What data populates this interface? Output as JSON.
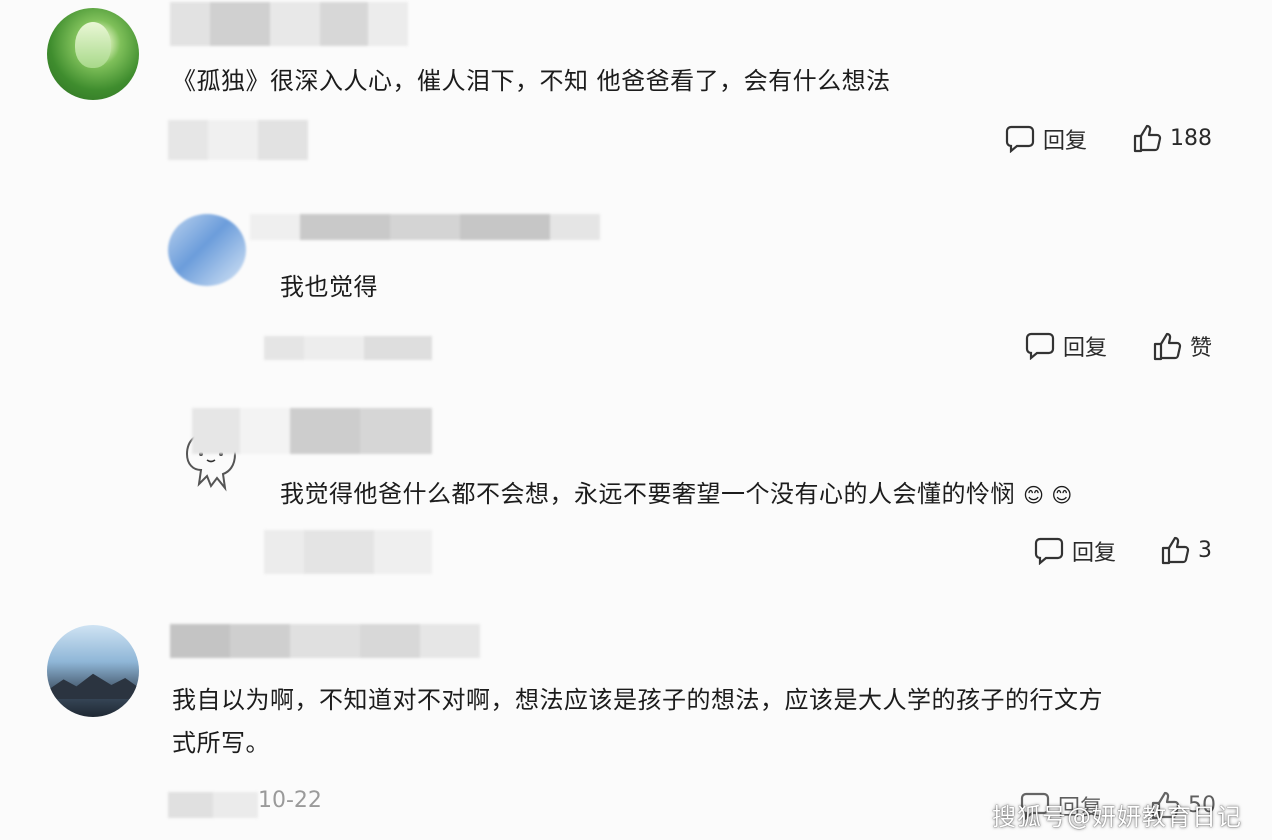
{
  "comments": [
    {
      "text": "《孤独》很深入人心，催人泪下，不知 他爸爸看了，会有什么想法",
      "reply_label": "回复",
      "like_count": "188"
    },
    {
      "text": "我也觉得",
      "reply_label": "回复",
      "like_count": "赞"
    },
    {
      "text": "我觉得他爸什么都不会想，永远不要奢望一个没有心的人会懂的怜悯",
      "emoji": "😊 😊",
      "reply_label": "回复",
      "like_count": "3"
    },
    {
      "text_line1": "我自以为啊，不知道对不对啊，想法应该是孩子的想法，应该是大人学的孩子的行文方",
      "text_line2": "式所写。",
      "reply_label": "回复",
      "like_count": "50",
      "timestamp": "10-22"
    }
  ],
  "watermark": "搜狐号@妍妍教育日记"
}
